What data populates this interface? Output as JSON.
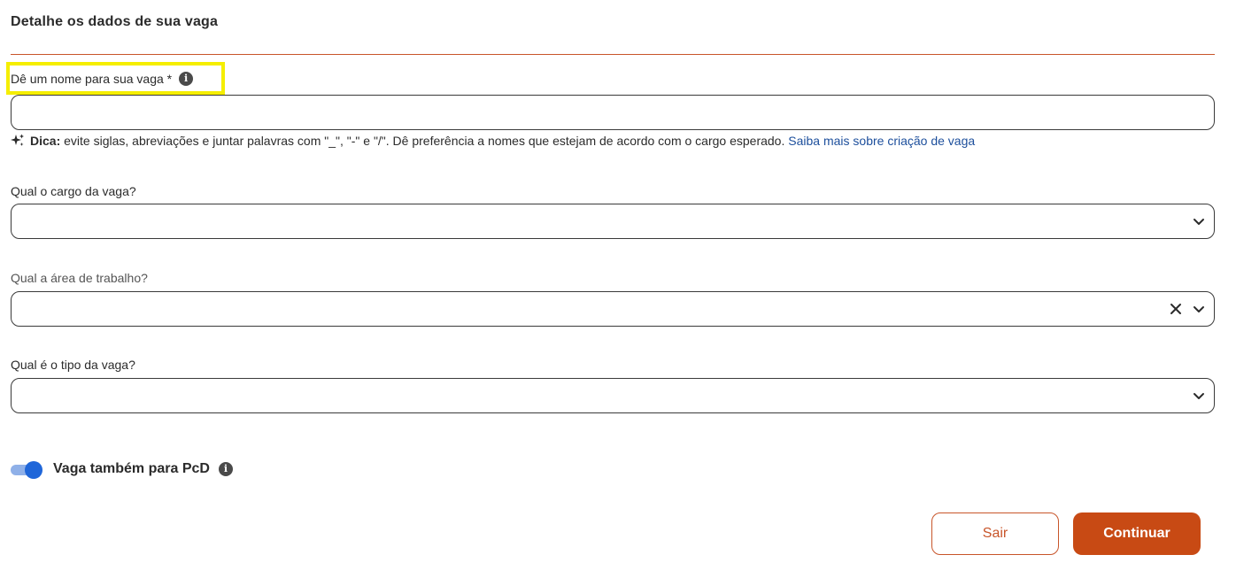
{
  "section": {
    "title": "Detalhe os dados de sua vaga"
  },
  "job_name": {
    "label": "Dê um nome para sua vaga *",
    "value": "",
    "placeholder": ""
  },
  "hint": {
    "bold": "Dica:",
    "text": "evite siglas, abreviações e juntar palavras com \"_\", \"-\" e \"/\". Dê preferência a nomes que estejam de acordo com o cargo esperado.",
    "link": "Saiba mais sobre criação de vaga"
  },
  "position": {
    "label": "Qual o cargo da vaga?",
    "value": ""
  },
  "work_area": {
    "label": "Qual a área de trabalho?",
    "value": ""
  },
  "job_type": {
    "label": "Qual é o tipo da vaga?",
    "value": ""
  },
  "pcd_toggle": {
    "label": "Vaga também para PcD",
    "checked": true
  },
  "buttons": {
    "exit": "Sair",
    "continue": "Continuar"
  },
  "colors": {
    "accent": "#c84a14",
    "divider": "#c8552a",
    "toggle_on": "#1f66d9",
    "link": "#1d4f9c",
    "highlight": "#f5ee00"
  }
}
